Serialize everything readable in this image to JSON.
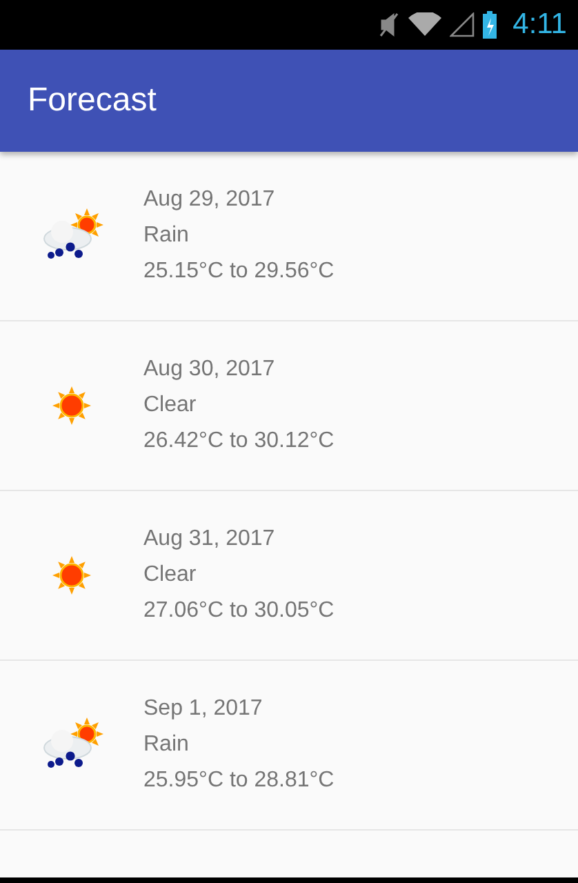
{
  "status_bar": {
    "time": "4:11"
  },
  "app_bar": {
    "title": "Forecast"
  },
  "forecasts": [
    {
      "kind": "rain",
      "date": "Aug 29, 2017",
      "condition": "Rain",
      "temperature": "25.15°C to 29.56°C"
    },
    {
      "kind": "clear",
      "date": "Aug 30, 2017",
      "condition": "Clear",
      "temperature": "26.42°C to 30.12°C"
    },
    {
      "kind": "clear",
      "date": "Aug 31, 2017",
      "condition": "Clear",
      "temperature": "27.06°C to 30.05°C"
    },
    {
      "kind": "rain",
      "date": "Sep 1, 2017",
      "condition": "Rain",
      "temperature": "25.95°C to 28.81°C"
    }
  ]
}
